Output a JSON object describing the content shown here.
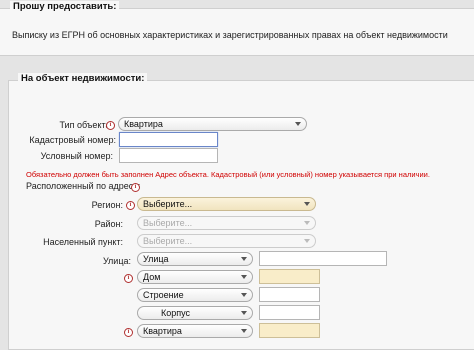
{
  "request_section": {
    "legend": "Прошу предоставить:",
    "text": "Выписку из ЕГРН об основных характеристиках и зарегистрированных правах на объект недвижимости"
  },
  "object_section": {
    "legend": "На объект недвижимости:",
    "object_type": {
      "label": "Тип объекта:",
      "value": "Квартира"
    },
    "cadastral": {
      "label": "Кадастровый номер:",
      "value": ""
    },
    "conditional": {
      "label": "Условный номер:",
      "value": ""
    },
    "warning": "Обязательно должен быть заполнен Адрес объекта. Кадастровый (или условный) номер указывается при наличии.",
    "address_heading": "Расположенный по адресу:",
    "region": {
      "label": "Регион:",
      "value": "Выберите..."
    },
    "district": {
      "label": "Район:",
      "value": "Выберите..."
    },
    "locality": {
      "label": "Населенный пункт:",
      "value": "Выберите..."
    },
    "street": {
      "label": "Улица:",
      "type": "Улица",
      "value": ""
    },
    "house": {
      "type": "Дом",
      "value": ""
    },
    "building": {
      "type": "Строение",
      "value": ""
    },
    "korpus": {
      "type": "Корпус",
      "value": ""
    },
    "apartment": {
      "type": "Квартира",
      "value": ""
    }
  },
  "icons": {
    "info": "i"
  },
  "colors": {
    "warning": "#d00000",
    "required_field": "#f9edc9",
    "info_icon": "#b03030"
  }
}
